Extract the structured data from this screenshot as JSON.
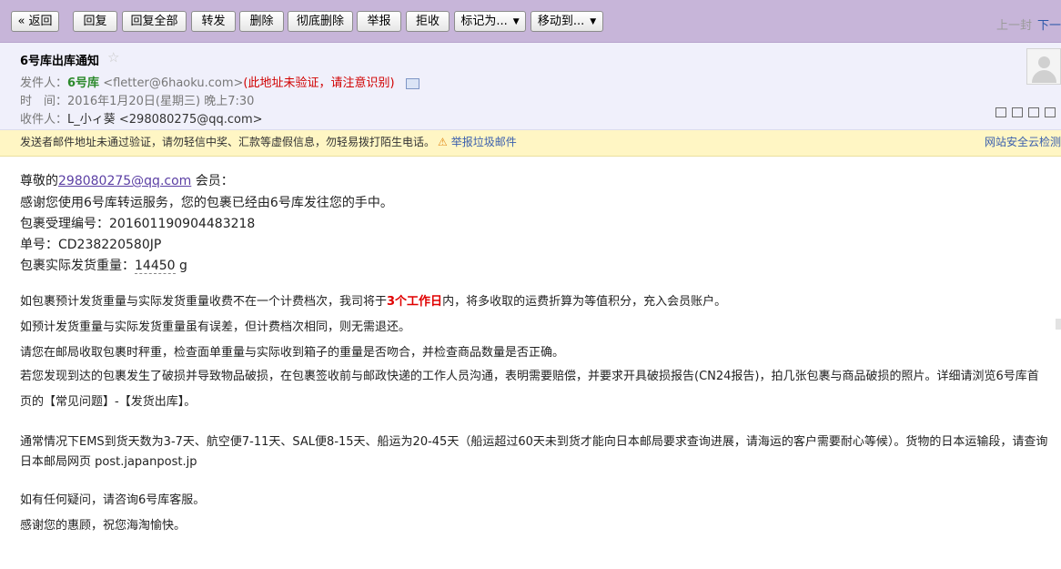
{
  "toolbar": {
    "back": "« 返回",
    "reply": "回复",
    "reply_all": "回复全部",
    "forward": "转发",
    "delete": "删除",
    "delete_permanently": "彻底删除",
    "report": "举报",
    "reject": "拒收",
    "mark_as": "标记为...",
    "move_to": "移动到...",
    "prev": "上一封",
    "next": "下一"
  },
  "header": {
    "subject": "6号库出库通知",
    "sender_label": "发件人：",
    "sender_name": "6号库",
    "sender_email": "<fletter@6haoku.com>",
    "sender_warning": "(此地址未验证，请注意识别)",
    "time_label": "时　间：",
    "time_value": "2016年1月20日(星期三) 晚上7:30",
    "recipient_label": "收件人：",
    "recipient_value": "L_小ィ葵 <298080275@qq.com>"
  },
  "warning_bar": {
    "message": "发送者邮件地址未通过验证，请勿轻信中奖、汇款等虚假信息，勿轻易拨打陌生电话。",
    "report_link": "举报垃圾邮件",
    "cloud_check": "网站安全云检测"
  },
  "body": {
    "greeting_prefix": "尊敬的",
    "greeting_email": "298080275@qq.com",
    "greeting_suffix": " 会员：",
    "line_thanks": "感谢您使用6号库转运服务，您的包裹已经由6号库发往您的手中。",
    "line_acceptance": "包裹受理编号：201601190904483218",
    "line_tracking": "单号：CD238220580JP",
    "weight_label": "包裹实际发货重量：",
    "weight_value": "14450",
    "weight_unit": " g",
    "para1_a": "如包裹预计发货重量与实际发货重量收费不在一个计费档次，我司将于",
    "para1_red": "3个工作日",
    "para1_b": "内，将多收取的运费折算为等值积分，充入会员账户。",
    "para2": "如预计发货重量与实际发货重量虽有误差，但计费档次相同，则无需退还。",
    "para3": "请您在邮局收取包裹时秤重，检查面单重量与实际收到箱子的重量是否吻合，并检查商品数量是否正确。",
    "para4": "若您发现到达的包裹发生了破损并导致物品破损，在包裹签收前与邮政快递的工作人员沟通，表明需要赔偿，并要求开具破损报告(CN24报告)，拍几张包裹与商品破损的照片。详细请浏览6号库首页的【常见问题】-【发货出库】。",
    "para5": "通常情况下EMS到货天数为3-7天、航空便7-11天、SAL便8-15天、船运为20-45天（船运超过60天未到货才能向日本邮局要求查询进展，请海运的客户需要耐心等候）。货物的日本运输段，请查询日本邮局网页 post.japanpost.jp",
    "para6": "如有任何疑问，请咨询6号库客服。",
    "para7": "感谢您的惠顾，祝您海淘愉快。"
  }
}
